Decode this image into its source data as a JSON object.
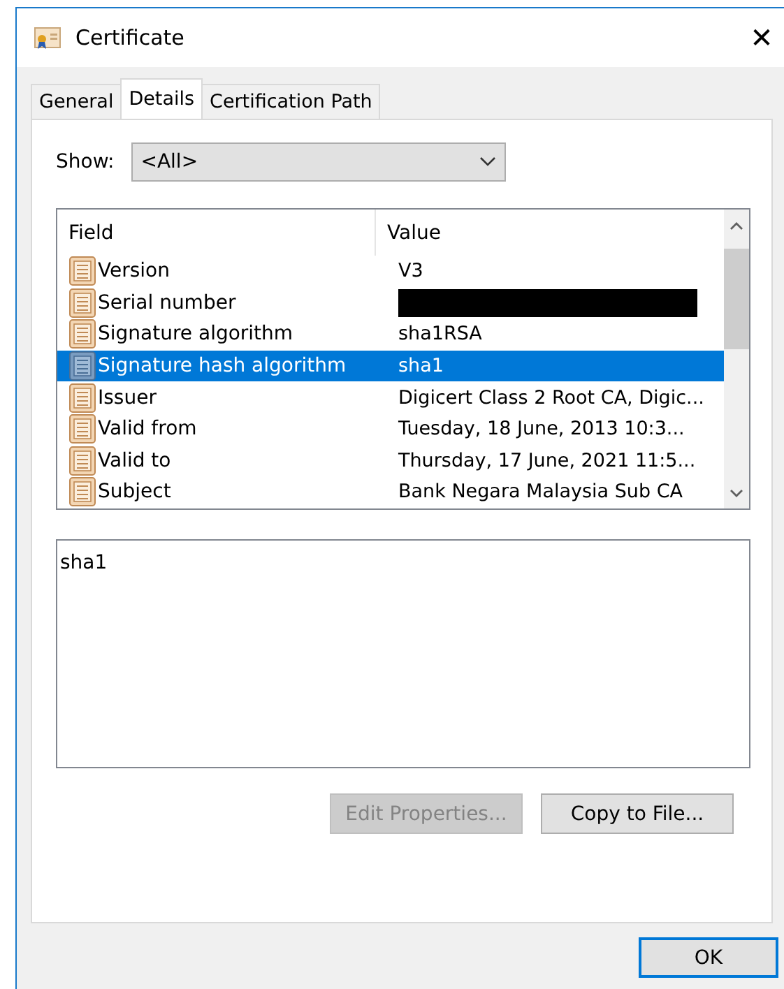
{
  "window": {
    "title": "Certificate",
    "close": "✕"
  },
  "tabs": [
    {
      "label": "General",
      "selected": false
    },
    {
      "label": "Details",
      "selected": true
    },
    {
      "label": "Certification Path",
      "selected": false
    }
  ],
  "show": {
    "label": "Show:",
    "value": "<All>"
  },
  "table": {
    "columns": [
      "Field",
      "Value"
    ],
    "rows": [
      {
        "field": "Version",
        "value": "V3",
        "selected": false
      },
      {
        "field": "Serial number",
        "redacted": true,
        "selected": false
      },
      {
        "field": "Signature algorithm",
        "value": "sha1RSA",
        "selected": false
      },
      {
        "field": "Signature hash algorithm",
        "value": "sha1",
        "selected": true
      },
      {
        "field": "Issuer",
        "value": "Digicert Class 2 Root CA, Digic...",
        "selected": false
      },
      {
        "field": "Valid from",
        "value": "Tuesday, 18 June, 2013 10:3...",
        "selected": false
      },
      {
        "field": "Valid to",
        "value": "Thursday, 17 June, 2021 11:5...",
        "selected": false
      },
      {
        "field": "Subject",
        "value": "Bank Negara Malaysia Sub CA",
        "selected": false
      }
    ]
  },
  "detail": {
    "text": "sha1"
  },
  "buttons": [
    {
      "label": "Edit Properties...",
      "disabled": true
    },
    {
      "label": "Copy to File...",
      "disabled": false
    }
  ],
  "footer": {
    "ok": "OK"
  }
}
